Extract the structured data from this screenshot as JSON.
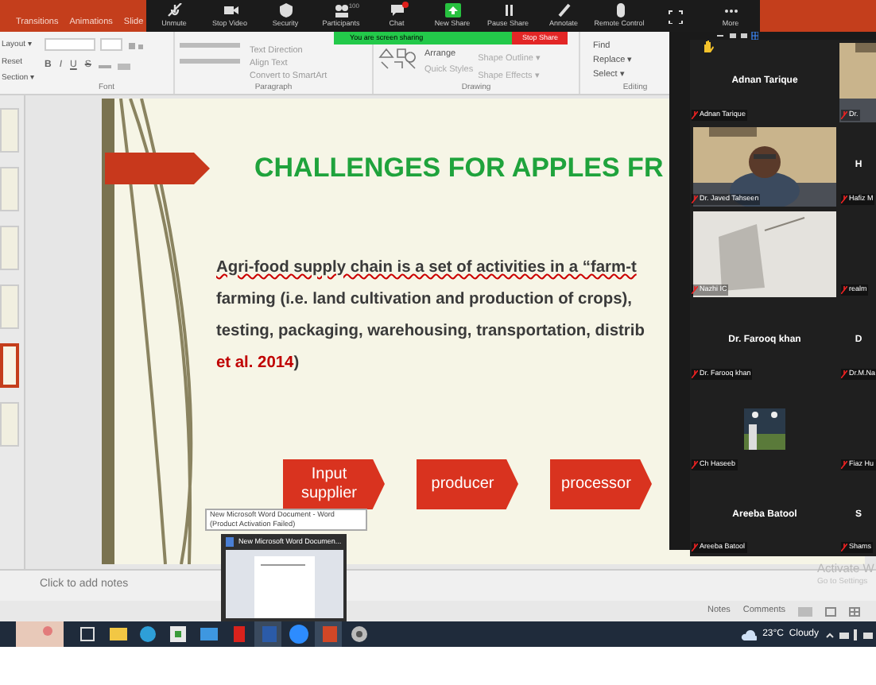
{
  "ppt_tabs": [
    {
      "label": "Transitions"
    },
    {
      "label": "Animations"
    },
    {
      "label": "Slide"
    }
  ],
  "zoom_toolbar": [
    {
      "kind": "mic-muted",
      "label": "Unmute"
    },
    {
      "kind": "camera",
      "label": "Stop Video"
    },
    {
      "kind": "shield",
      "label": "Security"
    },
    {
      "kind": "people",
      "label": "Participants",
      "count": "100"
    },
    {
      "kind": "chat",
      "label": "Chat",
      "notification": true
    },
    {
      "kind": "share",
      "label": "New Share"
    },
    {
      "kind": "pause",
      "label": "Pause Share"
    },
    {
      "kind": "pencil",
      "label": "Annotate"
    },
    {
      "kind": "mouse",
      "label": "Remote Control"
    },
    {
      "kind": "frame"
    },
    {
      "kind": "dots",
      "label": "More"
    }
  ],
  "share_bar": {
    "text": "You are screen sharing",
    "stop": "Stop Share"
  },
  "ribbon": {
    "slides_group": [
      "Layout ▾",
      "Reset",
      "Section ▾"
    ],
    "font_buttons": [
      "B",
      "I",
      "U",
      "S"
    ],
    "paragraph_items": [
      "Text Direction",
      "Align Text",
      "Convert to SmartArt"
    ],
    "drawing_items": [
      "Arrange",
      "Quick Styles",
      "Shape Outline ▾",
      "Shape Effects ▾"
    ],
    "editing_items": [
      "Find",
      "Replace ▾",
      "Select ▾"
    ],
    "groups": [
      "Font",
      "Paragraph",
      "Drawing",
      "Editing"
    ]
  },
  "thumbnails": [
    {
      "selected": false
    },
    {
      "selected": false
    },
    {
      "selected": false
    },
    {
      "selected": false
    },
    {
      "selected": true
    },
    {
      "selected": false
    }
  ],
  "slide": {
    "title": "CHALLENGES FOR APPLES FR",
    "body": "Agri-food supply chain is a set of activities in a “farm-t",
    "body_lines": [
      "farming (i.e. land cultivation and production of crops),",
      "testing, packaging, warehousing, transportation, distrib"
    ],
    "citation": "**et al. 2014**)",
    "flow": [
      "Input supplier",
      "producer",
      "processor"
    ]
  },
  "notes_placeholder": "Click to add notes",
  "status_bar": {
    "notes": "Notes",
    "comments": "Comments"
  },
  "activation": {
    "title": "Activate W",
    "subtitle": "Go to Settings"
  },
  "taskbar_tooltip": "New Microsoft Word Document - Word (Product Activation Failed)",
  "taskbar_preview": {
    "title": "New Microsoft Word Documen..."
  },
  "taskbar": {
    "icons": [
      {
        "kind": "taskview",
        "selected": false
      },
      {
        "kind": "folder",
        "selected": false
      },
      {
        "kind": "edge",
        "selected": false
      },
      {
        "kind": "store",
        "selected": false
      },
      {
        "kind": "mail",
        "selected": false
      },
      {
        "kind": "media",
        "selected": false
      },
      {
        "kind": "word",
        "selected": true
      },
      {
        "kind": "zoom",
        "selected": false
      },
      {
        "kind": "powerpoint",
        "selected": true
      },
      {
        "kind": "gear-app",
        "selected": false
      }
    ],
    "weather": "23°C  Cloudy"
  },
  "gallery": [
    {
      "tiles": [
        {
          "kind": "name",
          "name": "Adnan Tarique",
          "label": "Adnan Tarique"
        },
        {
          "kind": "video",
          "label": "Dr."
        }
      ]
    },
    {
      "tiles": [
        {
          "kind": "video",
          "label": "Dr. Javed Tahseen"
        },
        {
          "kind": "name",
          "name": "H",
          "label": "Hafiz M"
        }
      ]
    },
    {
      "tiles": [
        {
          "kind": "video",
          "label": "Nazhi IC"
        },
        {
          "kind": "name",
          "label": "realm"
        }
      ]
    },
    {
      "tiles": [
        {
          "kind": "name",
          "name": "Dr. Farooq khan",
          "label": "Dr. Farooq khan"
        },
        {
          "kind": "name",
          "name": "D",
          "label": "Dr.M.Na"
        }
      ]
    },
    {
      "tiles": [
        {
          "label": "Ch Haseeb"
        },
        {
          "kind": "name",
          "label": "Fiaz Hu"
        }
      ]
    },
    {
      "tiles": [
        {
          "kind": "name",
          "name": "Areeba Batool",
          "label": "Areeba Batool"
        },
        {
          "kind": "name",
          "name": "S",
          "label": "Shams"
        }
      ]
    }
  ]
}
